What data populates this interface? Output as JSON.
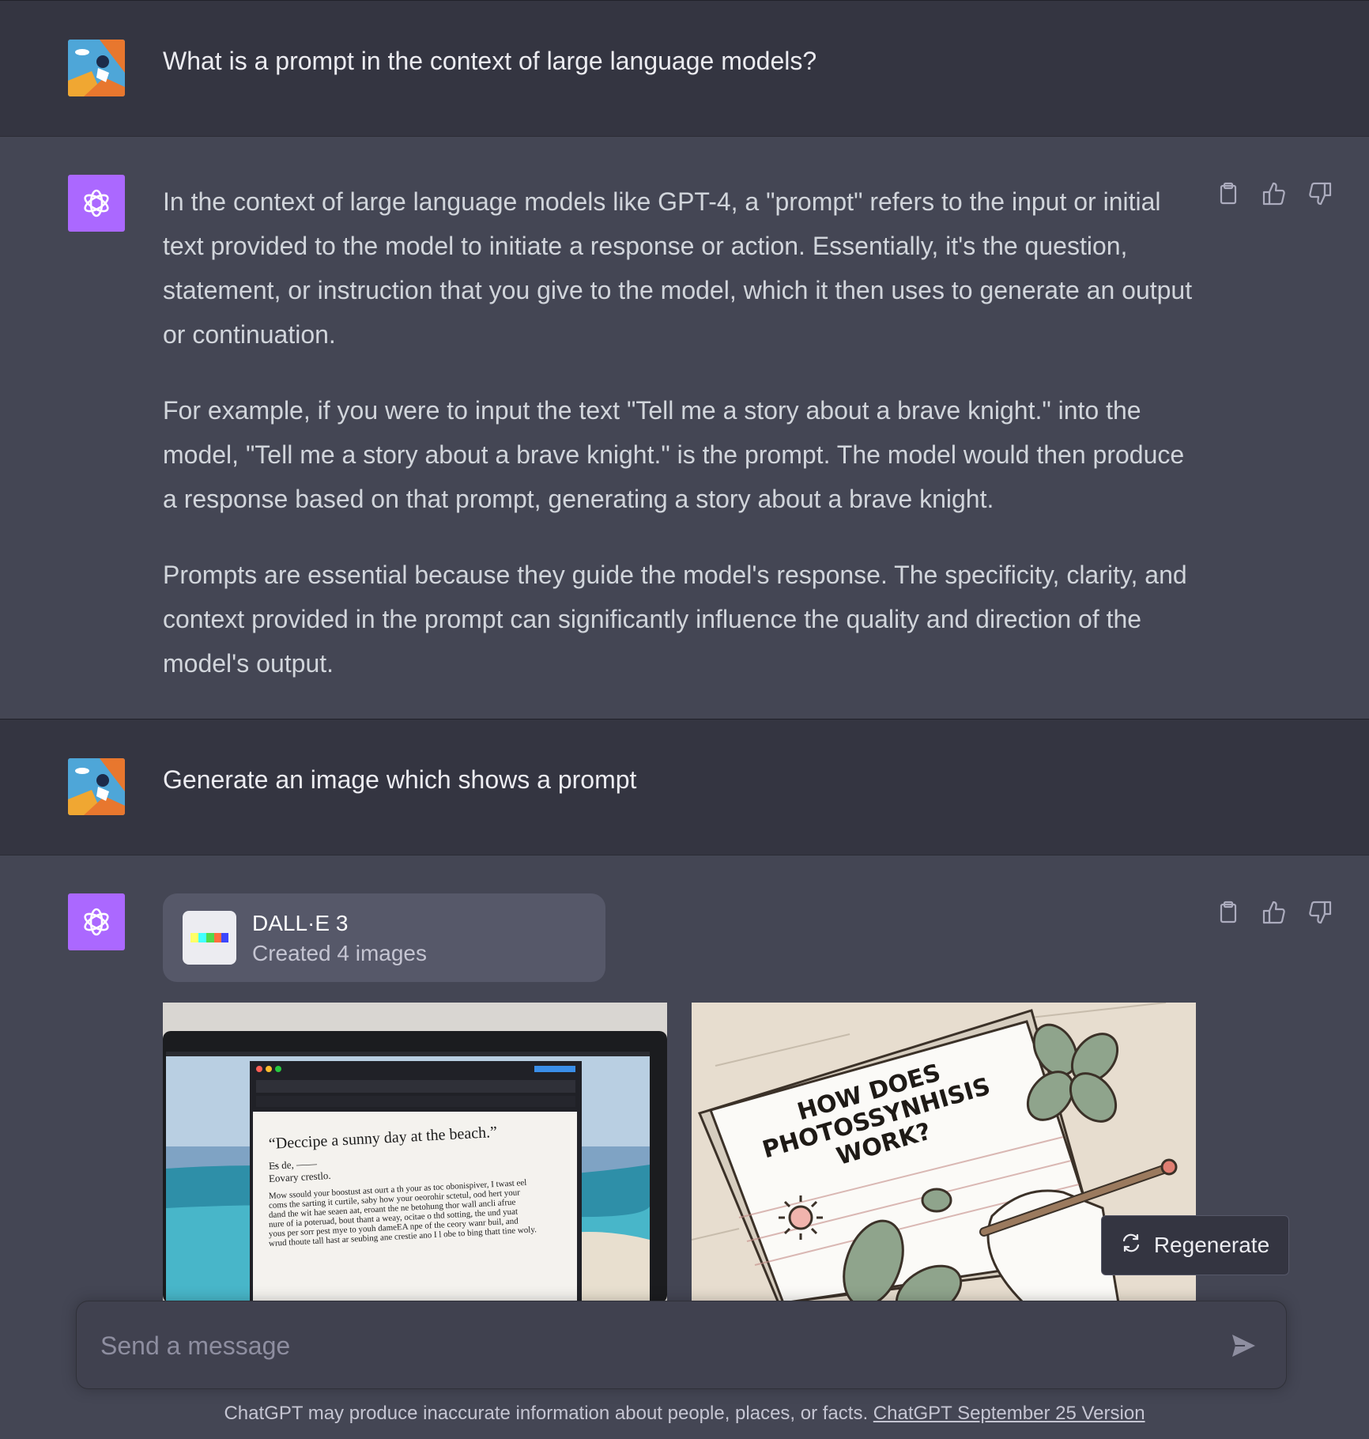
{
  "conversation": {
    "user_message_1": "What is a prompt in the context of large language models?",
    "assistant_message_1": {
      "paragraphs": [
        "In the context of large language models like GPT-4, a \"prompt\" refers to the input or initial text provided to the model to initiate a response or action. Essentially, it's the question, statement, or instruction that you give to the model, which it then uses to generate an output or continuation.",
        "For example, if you were to input the text \"Tell me a story about a brave knight.\" into the model, \"Tell me a story about a brave knight.\" is the prompt. The model would then produce a response based on that prompt, generating a story about a brave knight.",
        "Prompts are essential because they guide the model's response. The specificity, clarity, and context provided in the prompt can significantly influence the quality and direction of the model's output."
      ]
    },
    "user_message_2": "Generate an image which shows a prompt",
    "assistant_message_2": {
      "tool_name": "DALL·E 3",
      "tool_status": "Created 4 images",
      "images": [
        {
          "quote": "“Deccipe a sunny day at the beach.”",
          "lines": [
            "E̶s de, ——",
            "Eovary crestlo.",
            "Mow ssould your boostust ast ourt a th your as toc obonispiver, I twast eel",
            "coms the sarting it curtile, saby how your oeorohir sctetul, ood hert your",
            "dand the wit hae seaen aat, eroant the ne betohung thor wall ancli afrue",
            "nure of ia poteruad, bout thant a weay, ocitae o thd sotting, the und yuat",
            "yous per sorr pest mye to youh dameEA npe of the ceory wanr buil, and",
            "wrud thoute tall hast ar seubing ane crestie ano I l obe to bing thatt tine woly."
          ]
        },
        {
          "doodle_lines": [
            "HOW DOES",
            "PHOTOSSYNHISIS",
            "WORK?"
          ]
        }
      ]
    }
  },
  "regenerate_label": "Regenerate",
  "composer": {
    "placeholder": "Send a message"
  },
  "footer": {
    "disclaimer": "ChatGPT may produce inaccurate information about people, places, or facts.",
    "version_link": "ChatGPT September 25 Version"
  },
  "colors": {
    "background": "#343541",
    "assistant_background": "#444654",
    "gpt_avatar": "#ab68ff",
    "card": "#565869",
    "text": "#ececf1"
  },
  "icons": [
    "user-avatar-icon",
    "openai-logo-icon",
    "clipboard-icon",
    "thumbs-up-icon",
    "thumbs-down-icon",
    "dalle-logo-icon",
    "regenerate-icon",
    "send-icon"
  ]
}
